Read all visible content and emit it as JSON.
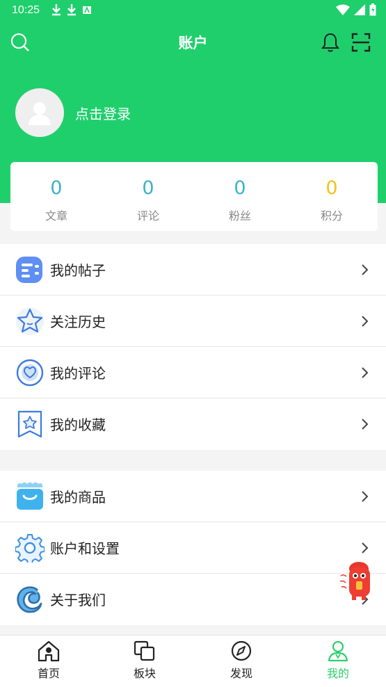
{
  "status_bar": {
    "time": "10:25"
  },
  "header": {
    "title": "账户",
    "login_text": "点击登录"
  },
  "stats": [
    {
      "value": "0",
      "label": "文章"
    },
    {
      "value": "0",
      "label": "评论"
    },
    {
      "value": "0",
      "label": "粉丝"
    },
    {
      "value": "0",
      "label": "积分"
    }
  ],
  "menu_group_1": [
    {
      "label": "我的帖子",
      "icon": "posts-icon"
    },
    {
      "label": "关注历史",
      "icon": "star-icon"
    },
    {
      "label": "我的评论",
      "icon": "heart-comment-icon"
    },
    {
      "label": "我的收藏",
      "icon": "bookmark-star-icon"
    }
  ],
  "menu_group_2": [
    {
      "label": "我的商品",
      "icon": "shopping-bag-icon"
    },
    {
      "label": "账户和设置",
      "icon": "gear-icon"
    },
    {
      "label": "关于我们",
      "icon": "brand-logo-icon"
    }
  ],
  "tabbar": [
    {
      "label": "首页",
      "icon": "home-icon"
    },
    {
      "label": "板块",
      "icon": "sections-icon"
    },
    {
      "label": "发现",
      "icon": "compass-icon"
    },
    {
      "label": "我的",
      "icon": "user-icon",
      "active": true
    }
  ],
  "colors": {
    "brand_green": "#1fcf6c",
    "stat_blue": "#3cb2c9",
    "points_yellow": "#f2c21c",
    "active_tab": "#2ecf6c"
  }
}
